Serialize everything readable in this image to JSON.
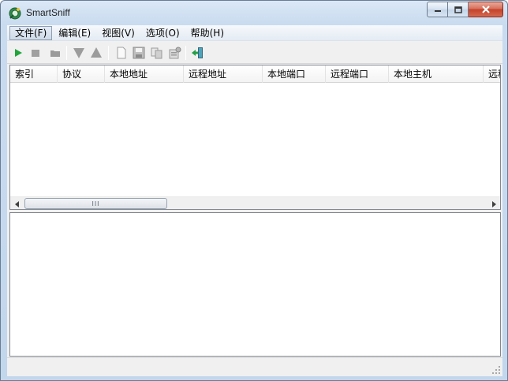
{
  "window": {
    "title": "SmartSniff"
  },
  "menu": {
    "items": [
      {
        "label": "文件(F)",
        "name": "menu-file"
      },
      {
        "label": "编辑(E)",
        "name": "menu-edit"
      },
      {
        "label": "视图(V)",
        "name": "menu-view"
      },
      {
        "label": "选项(O)",
        "name": "menu-options"
      },
      {
        "label": "帮助(H)",
        "name": "menu-help"
      }
    ]
  },
  "toolbar": {
    "icons": [
      "play-icon",
      "stop-icon",
      "folder-icon",
      "arrow-down-icon",
      "arrow-up-icon",
      "new-document-icon",
      "save-icon",
      "copy-icon",
      "properties-icon",
      "exit-icon"
    ]
  },
  "list": {
    "columns": [
      "索引",
      "协议",
      "本地地址",
      "远程地址",
      "本地端口",
      "远程端口",
      "本地主机",
      "远程"
    ],
    "rows": []
  },
  "scrollbar": {
    "grip": "III"
  },
  "colors": {
    "title_gradient_top": "#dbe8f6",
    "close_button": "#c4412a",
    "play_green": "#1fa53a",
    "disabled_gray": "#a0a0a0"
  }
}
